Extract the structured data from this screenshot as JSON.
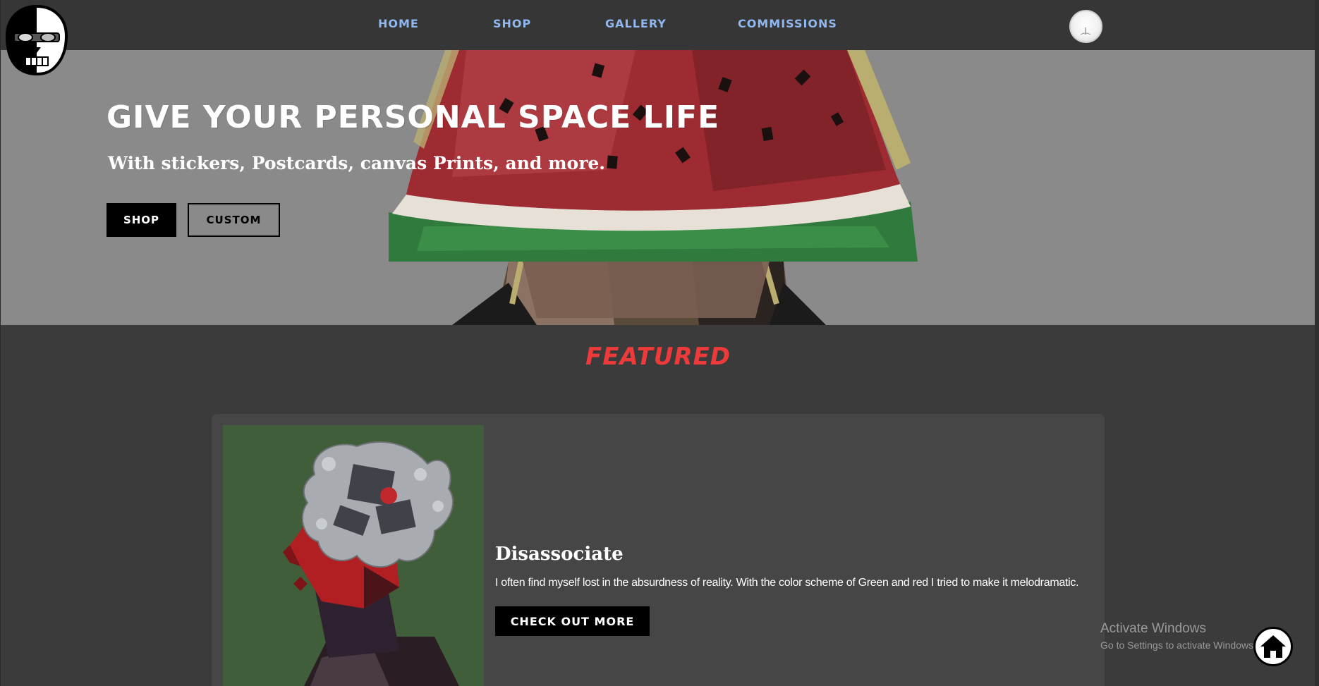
{
  "nav": {
    "links": [
      "HOME",
      "SHOP",
      "GALLERY",
      "COMMISSIONS"
    ],
    "link_color": "#8fb8f0"
  },
  "hero": {
    "title": "GIVE YOUR PERSONAL SPACE LIFE",
    "subtitle": "With stickers, Postcards, canvas Prints, and more.",
    "shop_button": "SHOP",
    "custom_button": "CUSTOM"
  },
  "featured": {
    "heading": "FEATURED",
    "heading_color": "#ee3a3a",
    "card": {
      "title": "Disassociate",
      "description": "I often find myself lost in the absurdness of reality. With the color scheme of Green and red I tried to make it melodramatic.",
      "button": "CHECK OUT MORE"
    }
  },
  "os_overlay": {
    "title": "Activate Windows",
    "subtitle": "Go to Settings to activate Windows."
  }
}
